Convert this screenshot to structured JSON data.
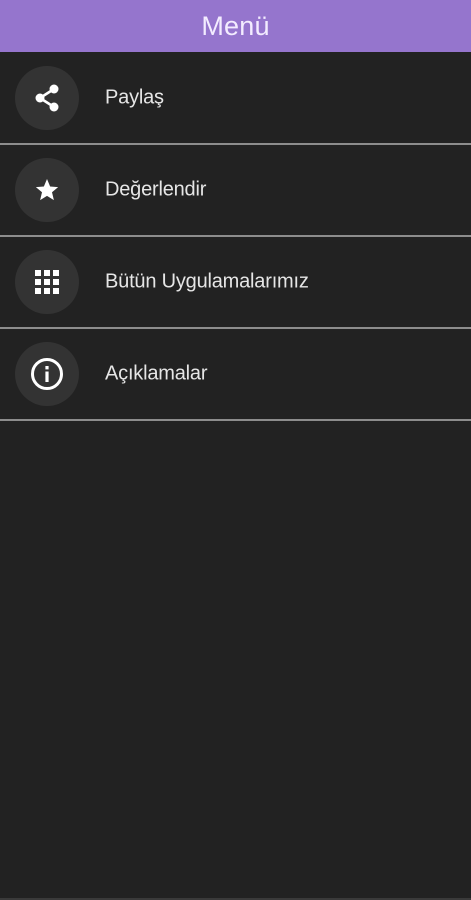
{
  "header": {
    "title": "Menü",
    "background_color": "#9575cd"
  },
  "menu": {
    "items": [
      {
        "label": "Paylaş",
        "icon": "share-icon"
      },
      {
        "label": "Değerlendir",
        "icon": "star-icon"
      },
      {
        "label": "Bütün Uygulamalarımız",
        "icon": "apps-grid-icon"
      },
      {
        "label": "Açıklamalar",
        "icon": "info-icon"
      }
    ]
  },
  "colors": {
    "background": "#222222",
    "divider": "#8d8d8d",
    "icon_circle": "#333333",
    "text": "#e6e6e6"
  }
}
